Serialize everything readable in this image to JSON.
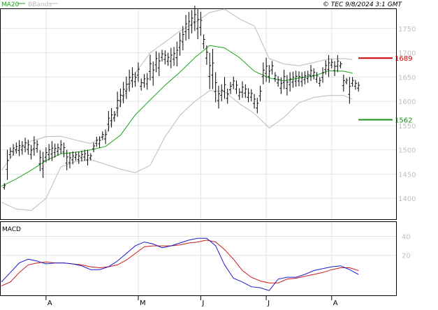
{
  "header": {
    "ma_label": "MA20",
    "bb_label": "BBands",
    "copyright": "© TEC 9/8/2024 3:1 GMT"
  },
  "macd_panel": {
    "label": "MACD"
  },
  "colors": {
    "price_bars": "#000000",
    "ma20": "#1aa51a",
    "bbands": "#bbbbbb",
    "resistance": "#cc0000",
    "support": "#1a8f1a",
    "macd_line": "#1a1acc",
    "signal_line": "#cc1a1a",
    "grid": "#e4e4e4",
    "axis_text": "#bfbfbf"
  },
  "chart_data": [
    {
      "type": "ohlc",
      "y_ticks": [
        1400,
        1450,
        1500,
        1550,
        1600,
        1650,
        1700,
        1750
      ],
      "ylim": [
        1357,
        1790
      ],
      "x_month_labels": [
        {
          "label": "A",
          "day": 15
        },
        {
          "label": "M",
          "day": 46
        },
        {
          "label": "J",
          "day": 67
        },
        {
          "label": "J",
          "day": 89
        },
        {
          "label": "A",
          "day": 111
        }
      ],
      "x_range": [
        0,
        131
      ],
      "grid": true,
      "levels": [
        {
          "name": "resistance",
          "value": 1689,
          "label": "1689"
        },
        {
          "name": "support",
          "value": 1562,
          "label": "1562"
        }
      ],
      "series": [
        {
          "name": "MA20",
          "x": [
            0,
            5,
            10,
            15,
            20,
            25,
            30,
            35,
            40,
            45,
            50,
            55,
            60,
            65,
            70,
            75,
            80,
            85,
            90,
            95,
            100,
            105,
            110,
            115,
            118
          ],
          "values": [
            1425,
            1440,
            1458,
            1478,
            1492,
            1495,
            1500,
            1507,
            1530,
            1572,
            1603,
            1633,
            1660,
            1690,
            1715,
            1710,
            1690,
            1662,
            1648,
            1642,
            1648,
            1652,
            1663,
            1662,
            1658
          ]
        },
        {
          "name": "BBands",
          "x": [
            0,
            5,
            10,
            15,
            20,
            25,
            30,
            35,
            40,
            45,
            50,
            55,
            60,
            65,
            70,
            75,
            80,
            85,
            90,
            95,
            100,
            105,
            110,
            115,
            118
          ],
          "upper": [
            1457,
            1500,
            1518,
            1527,
            1528,
            1520,
            1513,
            1530,
            1595,
            1658,
            1700,
            1722,
            1745,
            1762,
            1783,
            1790,
            1770,
            1755,
            1688,
            1677,
            1673,
            1680,
            1687,
            1688,
            1686
          ],
          "lower": [
            1392,
            1378,
            1375,
            1400,
            1465,
            1476,
            1480,
            1470,
            1460,
            1453,
            1468,
            1527,
            1571,
            1600,
            1622,
            1620,
            1595,
            1575,
            1545,
            1567,
            1597,
            1608,
            1612,
            1612,
            1604
          ]
        },
        {
          "name": "OHLC",
          "bars": [
            [
              1,
              1418,
              1431
            ],
            [
              2,
              1438,
              1500
            ],
            [
              3,
              1482,
              1505
            ],
            [
              4,
              1488,
              1512
            ],
            [
              5,
              1492,
              1515
            ],
            [
              6,
              1487,
              1520
            ],
            [
              7,
              1490,
              1518
            ],
            [
              8,
              1495,
              1525
            ],
            [
              9,
              1490,
              1521
            ],
            [
              10,
              1480,
              1510
            ],
            [
              11,
              1488,
              1528
            ],
            [
              12,
              1494,
              1520
            ],
            [
              13,
              1456,
              1499
            ],
            [
              14,
              1442,
              1496
            ],
            [
              15,
              1474,
              1505
            ],
            [
              16,
              1478,
              1512
            ],
            [
              17,
              1477,
              1518
            ],
            [
              18,
              1484,
              1513
            ],
            [
              19,
              1488,
              1513
            ],
            [
              20,
              1492,
              1520
            ],
            [
              21,
              1485,
              1515
            ],
            [
              22,
              1458,
              1500
            ],
            [
              23,
              1462,
              1495
            ],
            [
              24,
              1470,
              1497
            ],
            [
              25,
              1478,
              1496
            ],
            [
              26,
              1471,
              1496
            ],
            [
              27,
              1476,
              1498
            ],
            [
              28,
              1477,
              1500
            ],
            [
              29,
              1468,
              1500
            ],
            [
              30,
              1478,
              1493
            ],
            [
              31,
              1495,
              1515
            ],
            [
              32,
              1506,
              1527
            ],
            [
              33,
              1504,
              1528
            ],
            [
              34,
              1520,
              1538
            ],
            [
              35,
              1512,
              1542
            ],
            [
              36,
              1538,
              1580
            ],
            [
              37,
              1546,
              1586
            ],
            [
              38,
              1558,
              1580
            ],
            [
              39,
              1568,
              1620
            ],
            [
              40,
              1588,
              1626
            ],
            [
              41,
              1596,
              1640
            ],
            [
              42,
              1605,
              1651
            ],
            [
              43,
              1620,
              1665
            ],
            [
              44,
              1628,
              1670
            ],
            [
              45,
              1630,
              1660
            ],
            [
              46,
              1640,
              1680
            ],
            [
              47,
              1622,
              1647
            ],
            [
              48,
              1628,
              1656
            ],
            [
              49,
              1624,
              1658
            ],
            [
              50,
              1643,
              1696
            ],
            [
              51,
              1632,
              1682
            ],
            [
              52,
              1660,
              1703
            ],
            [
              53,
              1652,
              1700
            ],
            [
              54,
              1682,
              1706
            ],
            [
              55,
              1676,
              1705
            ],
            [
              56,
              1673,
              1700
            ],
            [
              57,
              1668,
              1710
            ],
            [
              58,
              1673,
              1712
            ],
            [
              59,
              1672,
              1723
            ],
            [
              60,
              1694,
              1742
            ],
            [
              61,
              1705,
              1755
            ],
            [
              62,
              1725,
              1778
            ],
            [
              63,
              1728,
              1784
            ],
            [
              64,
              1740,
              1788
            ],
            [
              65,
              1745,
              1797
            ],
            [
              66,
              1728,
              1790
            ],
            [
              67,
              1735,
              1784
            ],
            [
              68,
              1708,
              1738
            ],
            [
              69,
              1675,
              1715
            ],
            [
              70,
              1625,
              1700
            ],
            [
              71,
              1625,
              1708
            ],
            [
              72,
              1598,
              1660
            ],
            [
              73,
              1585,
              1632
            ],
            [
              74,
              1600,
              1635
            ],
            [
              75,
              1605,
              1650
            ],
            [
              76,
              1595,
              1626
            ],
            [
              77,
              1615,
              1640
            ],
            [
              78,
              1625,
              1651
            ],
            [
              79,
              1615,
              1643
            ],
            [
              80,
              1603,
              1627
            ],
            [
              81,
              1607,
              1641
            ],
            [
              82,
              1607,
              1635
            ],
            [
              83,
              1598,
              1627
            ],
            [
              84,
              1600,
              1625
            ],
            [
              85,
              1585,
              1615
            ],
            [
              86,
              1575,
              1607
            ],
            [
              87,
              1600,
              1632
            ],
            [
              88,
              1635,
              1680
            ],
            [
              89,
              1640,
              1690
            ],
            [
              90,
              1638,
              1675
            ],
            [
              91,
              1655,
              1683
            ],
            [
              92,
              1640,
              1660
            ],
            [
              93,
              1630,
              1652
            ],
            [
              94,
              1615,
              1649
            ],
            [
              95,
              1625,
              1665
            ],
            [
              96,
              1612,
              1654
            ],
            [
              97,
              1620,
              1660
            ],
            [
              98,
              1628,
              1661
            ],
            [
              99,
              1630,
              1663
            ],
            [
              100,
              1631,
              1662
            ],
            [
              101,
              1630,
              1660
            ],
            [
              102,
              1635,
              1662
            ],
            [
              103,
              1638,
              1663
            ],
            [
              104,
              1642,
              1675
            ],
            [
              105,
              1645,
              1668
            ],
            [
              106,
              1638,
              1660
            ],
            [
              107,
              1630,
              1650
            ],
            [
              108,
              1638,
              1670
            ],
            [
              109,
              1655,
              1684
            ],
            [
              110,
              1650,
              1695
            ],
            [
              111,
              1668,
              1687
            ],
            [
              112,
              1652,
              1683
            ],
            [
              113,
              1660,
              1695
            ],
            [
              114,
              1668,
              1682
            ],
            [
              115,
              1620,
              1655
            ],
            [
              116,
              1635,
              1648
            ],
            [
              117,
              1595,
              1650
            ],
            [
              118,
              1630,
              1650
            ],
            [
              119,
              1624,
              1644
            ],
            [
              120,
              1620,
              1640
            ]
          ]
        }
      ]
    },
    {
      "type": "line",
      "title": "MACD",
      "y_ticks": [
        20,
        40
      ],
      "ylim": [
        -22,
        55
      ],
      "x_range": [
        0,
        131
      ],
      "series": [
        {
          "name": "MACD",
          "x": [
            0,
            3,
            6,
            9,
            12,
            15,
            18,
            21,
            24,
            27,
            30,
            33,
            36,
            39,
            42,
            45,
            48,
            51,
            54,
            57,
            60,
            63,
            66,
            69,
            72,
            75,
            78,
            81,
            84,
            87,
            90,
            93,
            96,
            99,
            102,
            105,
            108,
            111,
            114,
            117,
            120
          ],
          "values": [
            -8,
            2,
            12,
            16,
            14,
            11,
            12,
            12,
            11,
            9,
            5,
            5,
            8,
            14,
            22,
            30,
            34,
            32,
            28,
            30,
            33,
            36,
            38,
            38,
            30,
            10,
            -4,
            -8,
            -13,
            -14,
            -17,
            -5,
            -3,
            -3,
            0,
            4,
            6,
            8,
            9,
            5,
            0
          ]
        },
        {
          "name": "Signal",
          "x": [
            0,
            3,
            6,
            9,
            12,
            15,
            18,
            21,
            24,
            27,
            30,
            33,
            36,
            39,
            42,
            45,
            48,
            51,
            54,
            57,
            60,
            63,
            66,
            69,
            72,
            75,
            78,
            81,
            84,
            87,
            90,
            93,
            96,
            99,
            102,
            105,
            108,
            111,
            114,
            117,
            120
          ],
          "values": [
            -12,
            -8,
            2,
            10,
            12,
            13,
            12,
            12,
            11,
            10,
            8,
            7,
            8,
            10,
            15,
            22,
            29,
            30,
            30,
            30,
            31,
            33,
            34,
            36,
            34,
            26,
            16,
            4,
            -3,
            -7,
            -9,
            -9,
            -5,
            -4,
            -2,
            0,
            2,
            5,
            7,
            7,
            4
          ]
        }
      ]
    }
  ]
}
